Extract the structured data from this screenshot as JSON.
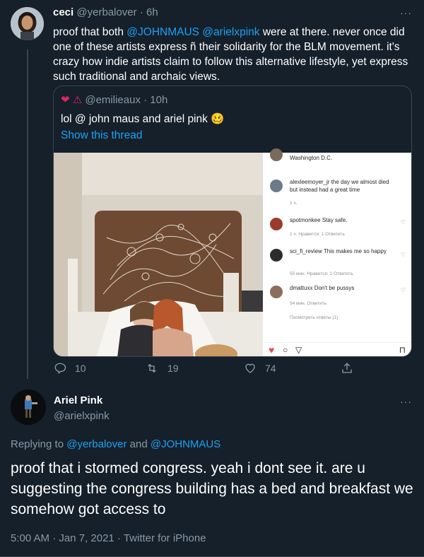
{
  "tweet1": {
    "name": "ceci",
    "handle": "@yerbalover",
    "sep": "·",
    "time": "6h",
    "text_before": "proof that both ",
    "mention1": "@JOHNMAUS",
    "mention2": "@arielxpink",
    "text_after": " were at there. never once did one of these artists express ñ their solidarity for the BLM movement. it's crazy how indie artists claim to follow this alternative lifestyle, yet express such traditional and archaic views.",
    "more": "···"
  },
  "quote": {
    "icons": "❤ ⚠",
    "handle": "@emilieaux",
    "sep": "·",
    "time": "10h",
    "text": "lol @ john maus and ariel pink 🥴",
    "show_thread": "Show this thread",
    "instagram": {
      "location": "Washington D.C.",
      "comments": [
        {
          "user": "alexleemoyer_jr",
          "text": "the day we almost died but instead had a great time",
          "meta": "1 ч."
        },
        {
          "user": "spotmonkee",
          "text": "Stay safe.",
          "meta": "1 ч.   Нравится: 1   Ответить"
        },
        {
          "user": "sci_fi_review",
          "text": "This makes me so happy",
          "meta": "55 мин.   Нравится: 1   Ответить"
        },
        {
          "user": "dmattuxx",
          "text": "Don't be pussys",
          "meta": "54 мин.   Ответить"
        }
      ],
      "view_replies": "Посмотреть ответы (1)"
    }
  },
  "actions": {
    "replies": "10",
    "retweets": "19",
    "likes": "74"
  },
  "tweet2": {
    "name": "Ariel Pink",
    "handle": "@arielxpink",
    "more": "···",
    "replying_prefix": "Replying to ",
    "replying_to1": "@yerbalover",
    "replying_and": " and ",
    "replying_to2": "@JOHNMAUS",
    "text": "proof that i stormed congress. yeah i dont see it. are u suggesting the congress building has a bed and breakfast we somehow got access to",
    "timestamp": "5:00 AM · Jan 7, 2021 · Twitter for iPhone"
  },
  "colors": {
    "background": "#15202b",
    "accent": "#1da1f2",
    "muted": "#8899a6",
    "border": "#38444d"
  }
}
